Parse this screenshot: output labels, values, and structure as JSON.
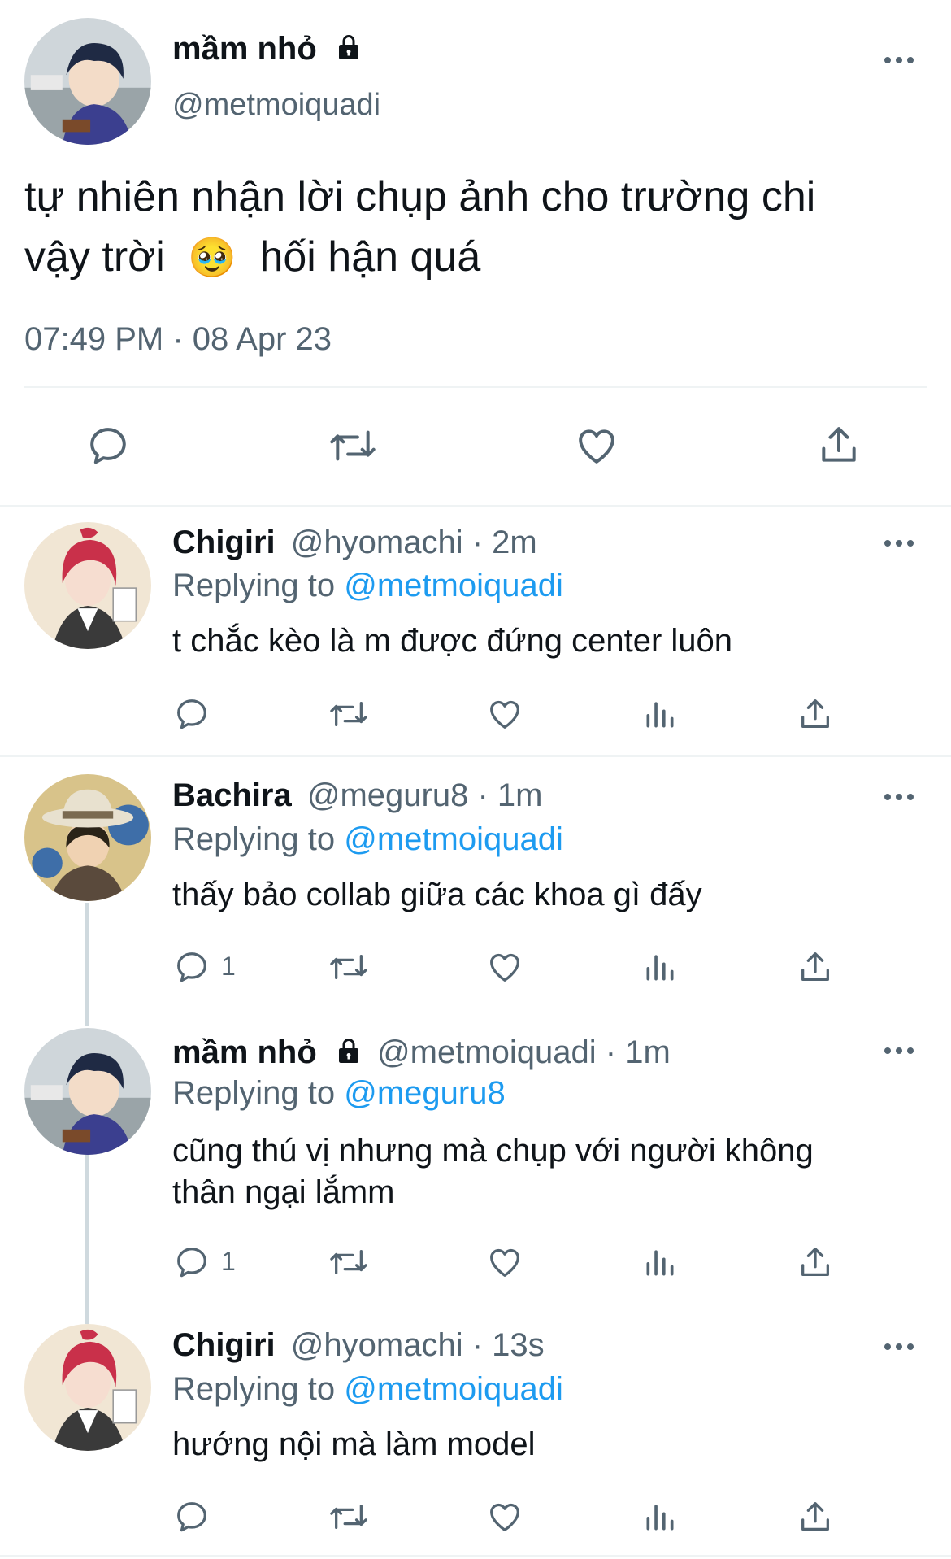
{
  "main_tweet": {
    "display_name": "mầm nhỏ",
    "handle": "@metmoiquadi",
    "text_line1": "tự nhiên nhận lời chụp ảnh cho trường chi",
    "text_line2a": "vậy trời",
    "emoji": "🥹",
    "text_line2b": "hối hận quá",
    "timestamp": "07:49 PM · 08 Apr 23",
    "icons": [
      "reply-icon",
      "retweet-icon",
      "like-icon",
      "share-icon"
    ]
  },
  "replies": [
    {
      "display_name": "Chigiri",
      "handle_time": "@hyomachi · 2m",
      "replying_label": "Replying to",
      "replying_to": "@metmoiquadi",
      "text": "t chắc kèo là m được đứng center luôn",
      "reply_count": ""
    },
    {
      "display_name": "Bachira",
      "handle_time": "@meguru8 · 1m",
      "replying_label": "Replying to",
      "replying_to": "@metmoiquadi",
      "text": "thấy bảo collab giữa các khoa gì đấy",
      "reply_count": "1"
    },
    {
      "display_name": "mầm nhỏ",
      "handle_time": "@metmoiquadi · 1m",
      "replying_label": "Replying to",
      "replying_to": "@meguru8",
      "text_line1": "cũng thú vị nhưng mà chụp với người không",
      "text_line2": "thân ngại lắmm",
      "reply_count": "1"
    },
    {
      "display_name": "Chigiri",
      "handle_time": "@hyomachi · 13s",
      "replying_label": "Replying to",
      "replying_to": "@metmoiquadi",
      "text": "hướng nội mà làm model",
      "reply_count": ""
    }
  ],
  "colors": {
    "text": "#0f1419",
    "muted": "#536471",
    "link": "#1d9bf0",
    "divider": "#eff3f4",
    "thread_line": "#cfd9de"
  }
}
